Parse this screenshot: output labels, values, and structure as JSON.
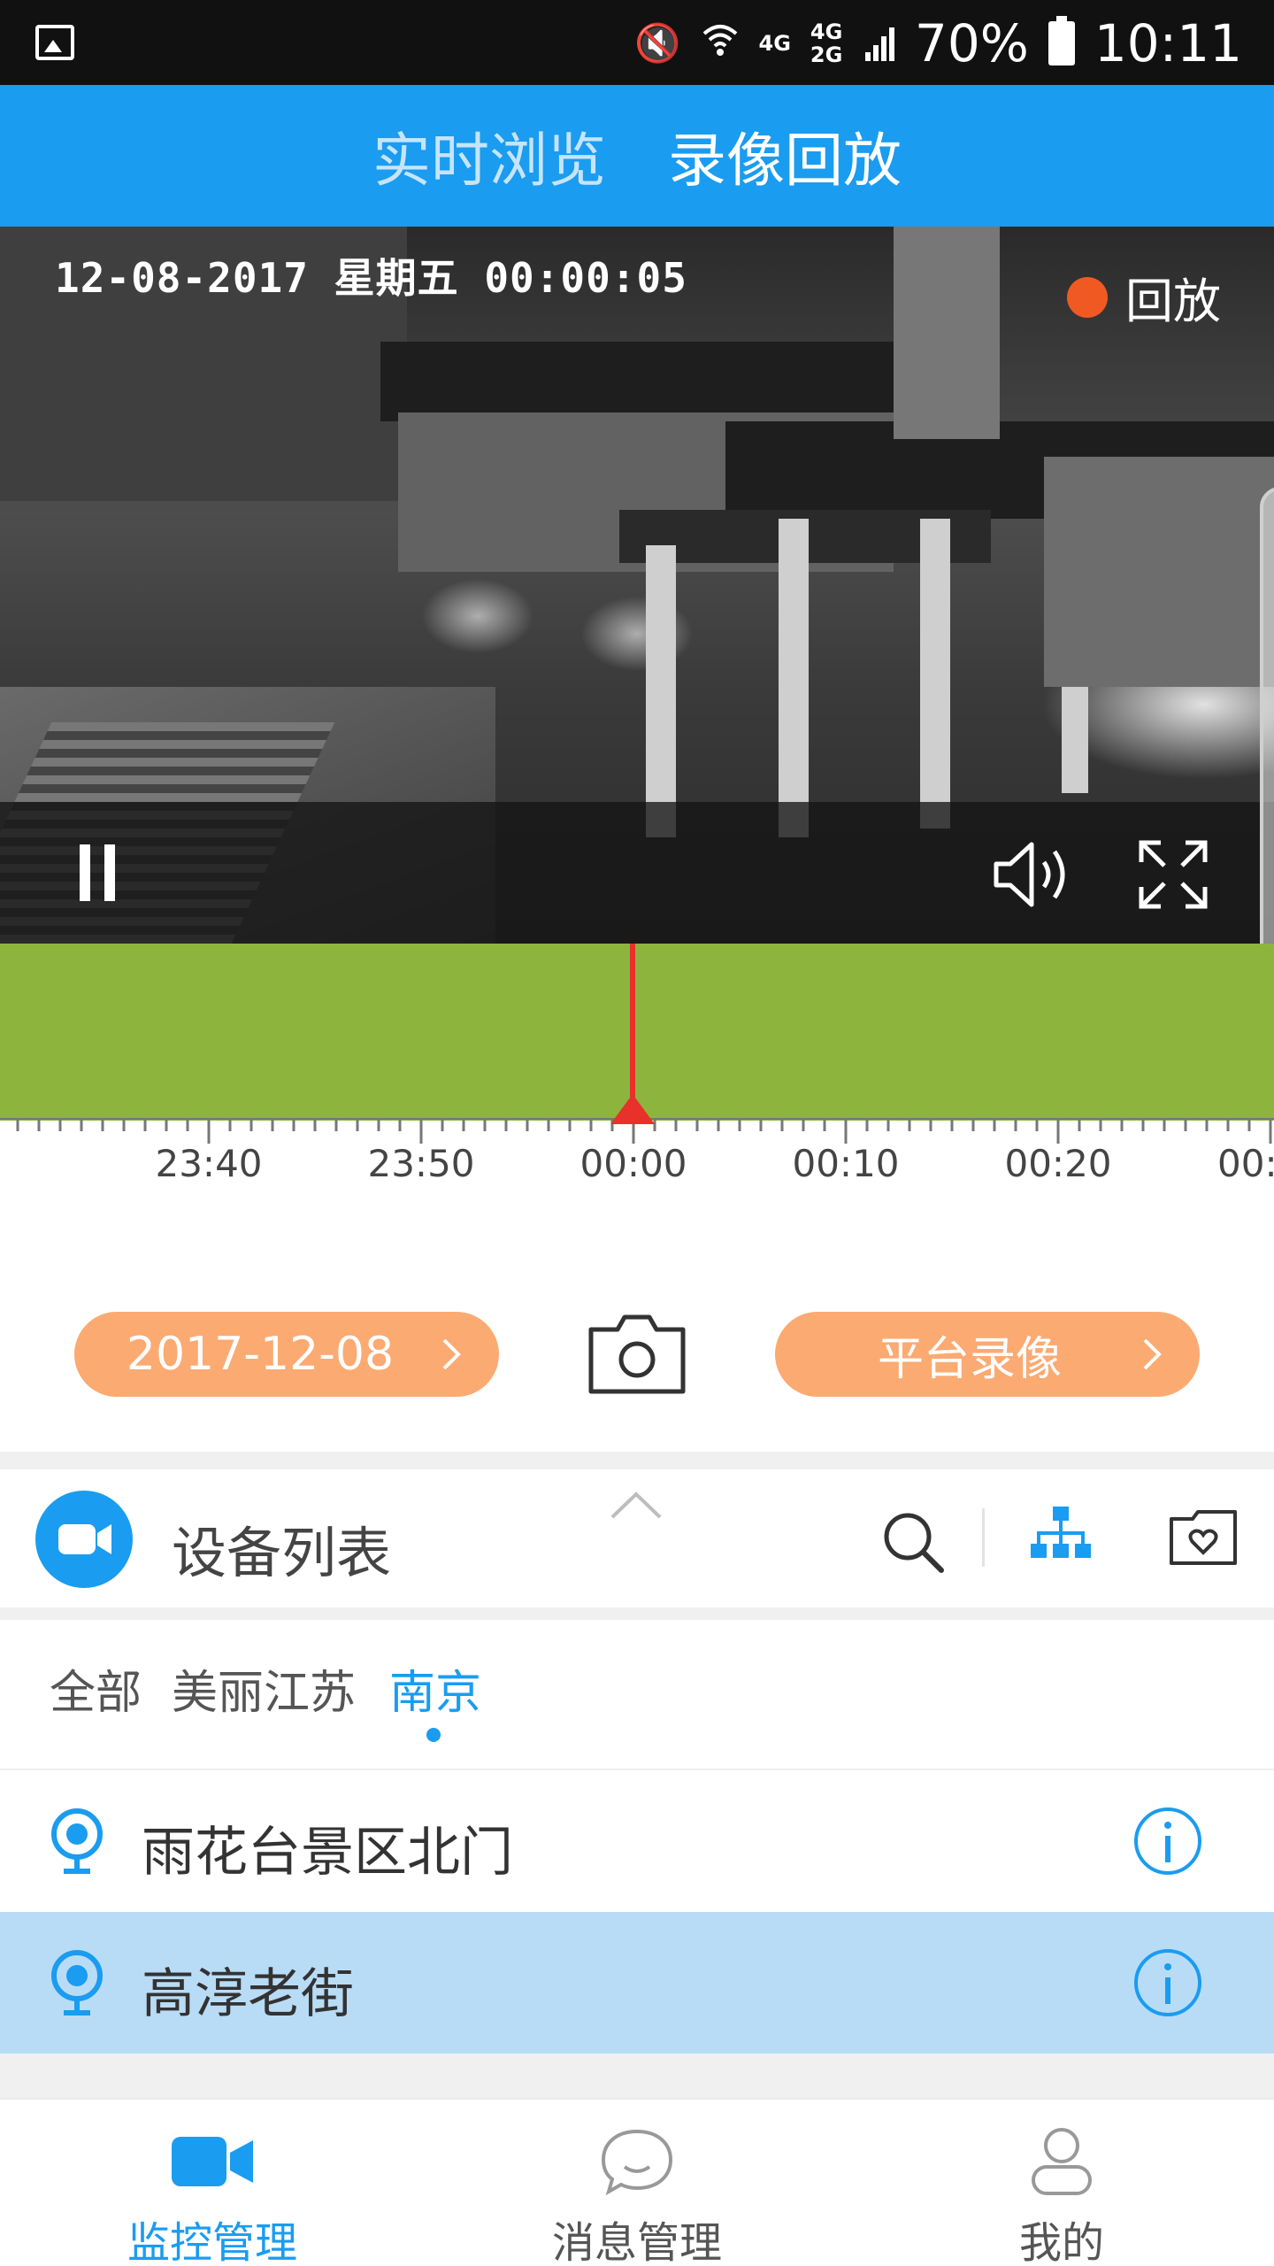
{
  "status_bar": {
    "network": "4G",
    "network2": "4G 2G",
    "battery": "70%",
    "time": "10:11"
  },
  "top_tabs": [
    {
      "label": "实时浏览",
      "active": false
    },
    {
      "label": "录像回放",
      "active": true
    }
  ],
  "video": {
    "osd_text": "12-08-2017 星期五 00:00:05",
    "badge_label": "回放",
    "badge_color": "#f05a22"
  },
  "timeline": {
    "bar_color": "#8db53e",
    "cursor_color": "#e8312b",
    "tick_labels": [
      "23:40",
      "23:50",
      "00:00",
      "00:10",
      "00:20",
      "00:"
    ]
  },
  "actions": {
    "date_label": "2017-12-08",
    "record_label": "平台录像",
    "pill_color": "#fbaa72"
  },
  "device_panel": {
    "title": "设备列表",
    "breadcrumbs": [
      {
        "label": "全部",
        "active": false
      },
      {
        "label": "美丽江苏",
        "active": false
      },
      {
        "label": "南京",
        "active": true
      }
    ],
    "devices": [
      {
        "name": "雨花台景区北门",
        "selected": false
      },
      {
        "name": "高淳老街",
        "selected": true
      }
    ]
  },
  "bottom_nav": [
    {
      "label": "监控管理",
      "icon": "video-camera-icon",
      "active": true
    },
    {
      "label": "消息管理",
      "icon": "chat-bubble-icon",
      "active": false
    },
    {
      "label": "我的",
      "icon": "user-icon",
      "active": false
    }
  ],
  "colors": {
    "accent": "#1a9cf0",
    "selected_row": "#b9dcf6"
  }
}
